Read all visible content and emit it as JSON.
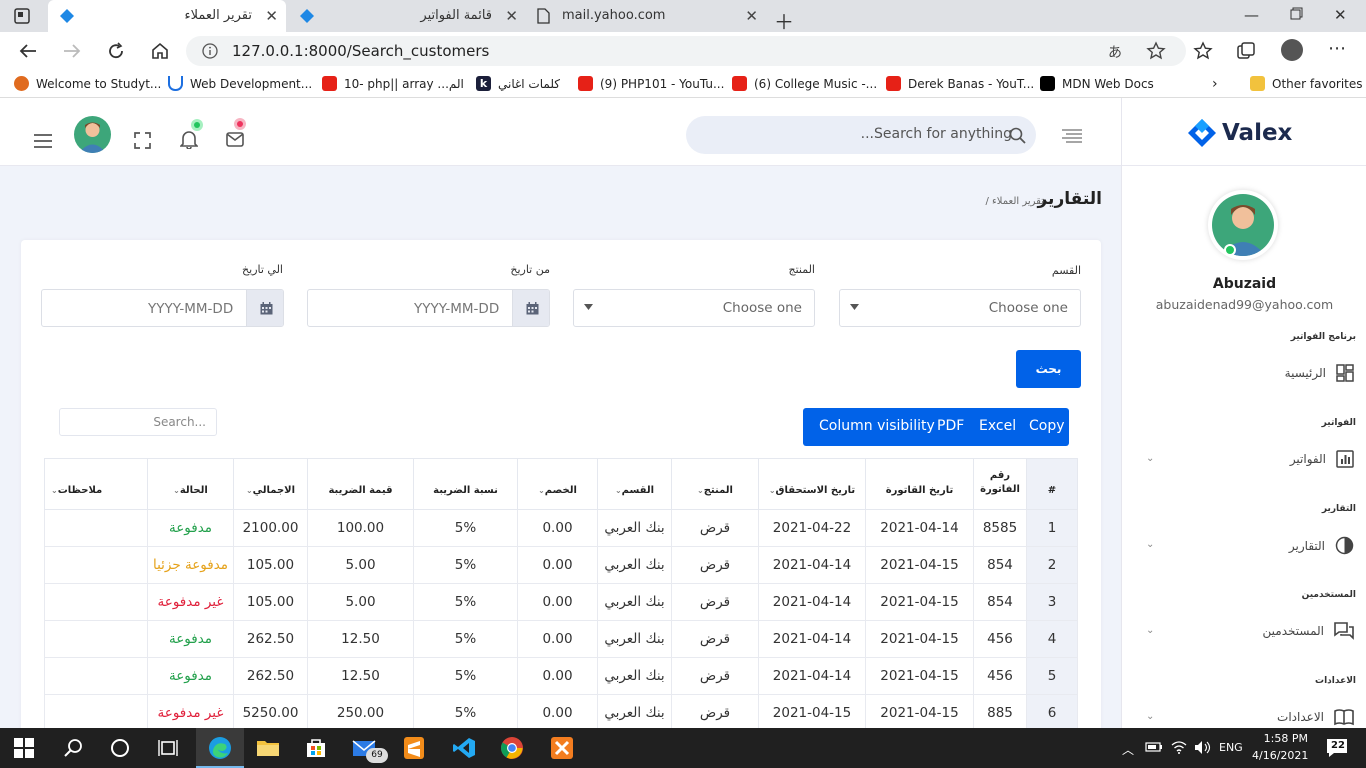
{
  "browser": {
    "tabs": [
      {
        "title": "تقرير العملاء",
        "active": true
      },
      {
        "title": "قائمة الفواتير",
        "active": false
      },
      {
        "title": "mail.yahoo.com",
        "active": false
      }
    ],
    "url": "127.0.0.1:8000/Search_customers",
    "bookmarks": [
      "Welcome to Studyt...",
      "Web Development...",
      "10- php|| array ...الم",
      "كلمات اغاني",
      "(9) PHP101 - YouTu...",
      "(6) College Music -...",
      "Derek Banas - YouT...",
      "MDN Web Docs"
    ],
    "other_favorites": "Other favorites"
  },
  "topnav": {
    "search_placeholder": "...Search for anything"
  },
  "page": {
    "title": "التقارير",
    "breadcrumb": "/ تقرير العملاء"
  },
  "filters": {
    "section_label": "القسم",
    "section_value": "Choose one",
    "product_label": "المنتج",
    "product_value": "Choose one",
    "from_label": "من تاريخ",
    "from_placeholder": "YYYY-MM-DD",
    "to_label": "الي تاريخ",
    "to_placeholder": "YYYY-MM-DD",
    "search_button": "بحث"
  },
  "table_tools": {
    "search_placeholder": "Search...",
    "buttons": [
      "Column visibility",
      "PDF",
      "Excel",
      "Copy"
    ]
  },
  "table": {
    "headers": {
      "num": "#",
      "invoice_no_1": "رقم",
      "invoice_no_2": "الفاتورة",
      "invoice_date": "تاريخ القاتورة",
      "due_date": "تاريخ الاستحقاق",
      "product": "المنتج",
      "section": "القسم",
      "discount": "الخصم",
      "tax_rate": "نسبة الضريبة",
      "tax_value": "قيمة الضريبة",
      "total": "الاجمالي",
      "status": "الحالة",
      "notes": "ملاحظات"
    },
    "rows": [
      {
        "n": "1",
        "inv": "8585",
        "inv_date": "2021-04-14",
        "due": "2021-04-22",
        "product": "قرض",
        "section": "بنك العربي",
        "discount": "0.00",
        "rate": "5%",
        "tax": "100.00",
        "total": "2100.00",
        "status": "مدفوعة",
        "status_color": "#22a04b",
        "notes": ""
      },
      {
        "n": "2",
        "inv": "854",
        "inv_date": "2021-04-15",
        "due": "2021-04-14",
        "product": "قرض",
        "section": "بنك العربي",
        "discount": "0.00",
        "rate": "5%",
        "tax": "5.00",
        "total": "105.00",
        "status": "مدفوعة جزئيا",
        "status_color": "#e5a21b",
        "notes": ""
      },
      {
        "n": "3",
        "inv": "854",
        "inv_date": "2021-04-15",
        "due": "2021-04-14",
        "product": "قرض",
        "section": "بنك العربي",
        "discount": "0.00",
        "rate": "5%",
        "tax": "5.00",
        "total": "105.00",
        "status": "غير مدفوعة",
        "status_color": "#e0213b",
        "notes": ""
      },
      {
        "n": "4",
        "inv": "456",
        "inv_date": "2021-04-15",
        "due": "2021-04-14",
        "product": "قرض",
        "section": "بنك العربي",
        "discount": "0.00",
        "rate": "5%",
        "tax": "12.50",
        "total": "262.50",
        "status": "مدفوعة",
        "status_color": "#22a04b",
        "notes": ""
      },
      {
        "n": "5",
        "inv": "456",
        "inv_date": "2021-04-15",
        "due": "2021-04-14",
        "product": "قرض",
        "section": "بنك العربي",
        "discount": "0.00",
        "rate": "5%",
        "tax": "12.50",
        "total": "262.50",
        "status": "مدفوعة",
        "status_color": "#22a04b",
        "notes": ""
      },
      {
        "n": "6",
        "inv": "885",
        "inv_date": "2021-04-15",
        "due": "2021-04-15",
        "product": "قرض",
        "section": "بنك العربي",
        "discount": "0.00",
        "rate": "5%",
        "tax": "250.00",
        "total": "5250.00",
        "status": "غير مدفوعة",
        "status_color": "#e0213b",
        "notes": ""
      }
    ]
  },
  "sidebar": {
    "brand": "Valex",
    "user_name": "Abuzaid",
    "user_email": "abuzaidenad99@yahoo.com",
    "sections": [
      {
        "heading": "برنامج الفواتير",
        "item": "الرئيسية"
      },
      {
        "heading": "الفواتير",
        "item": "الفواتير"
      },
      {
        "heading": "التقارير",
        "item": "التقارير"
      },
      {
        "heading": "المستخدمين",
        "item": "المستخدمين"
      },
      {
        "heading": "الاعدادات",
        "item": "الاعدادات"
      }
    ]
  },
  "taskbar": {
    "time": "1:58 PM",
    "date": "4/16/2021",
    "lang": "ENG",
    "mail_badge": "69",
    "notif_count": "22"
  },
  "colors": {
    "accent": "#0162e8",
    "paid": "#22a04b",
    "partial": "#e5a21b",
    "unpaid": "#e0213b"
  }
}
